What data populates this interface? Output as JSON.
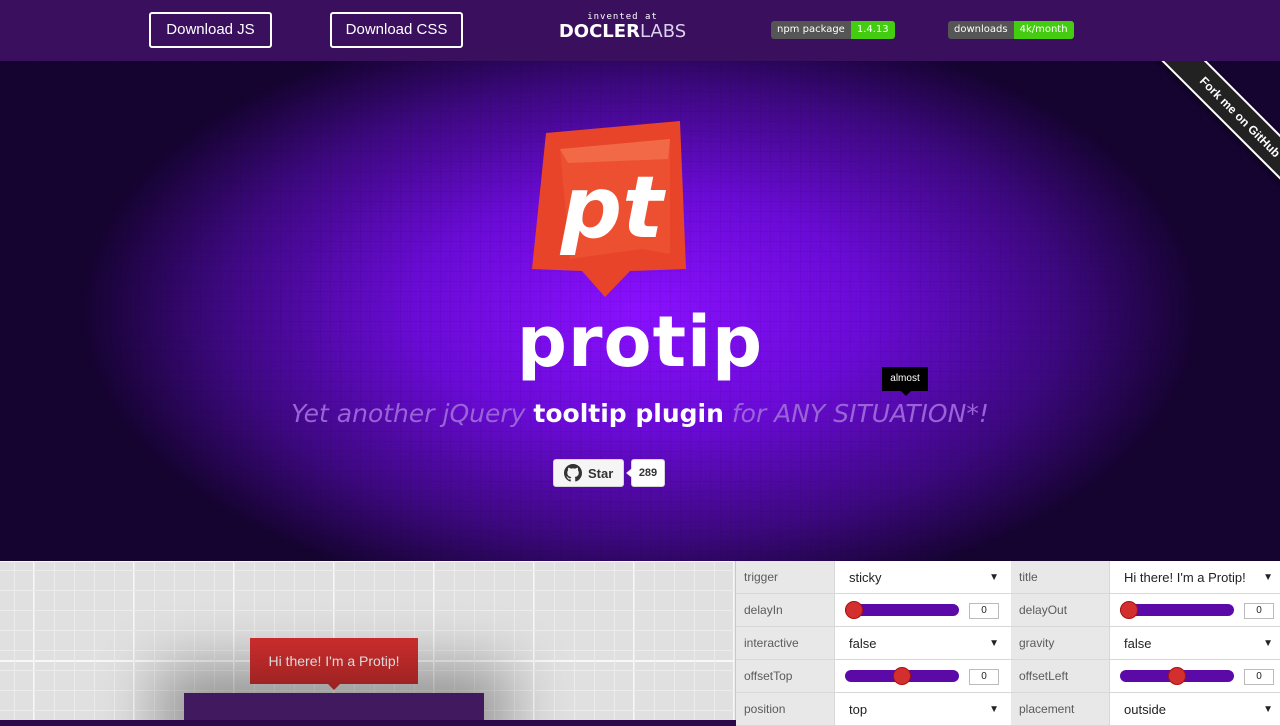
{
  "header": {
    "download_js": "Download JS",
    "download_css": "Download CSS",
    "logo_small": "invented at",
    "logo_main": "DOCLER",
    "logo_labs": "LABS",
    "npm_badge": {
      "label": "npm package",
      "value": "1.4.13"
    },
    "downloads_badge": {
      "label": "downloads",
      "value": "4k/month"
    }
  },
  "hero": {
    "title": "protip",
    "logo_letters": "pt",
    "tagline_pre": "Yet another jQuery ",
    "tagline_bold": "tooltip plugin",
    "tagline_post": " for ANY SITUATION*!",
    "almost_tip": "almost",
    "star_label": "Star",
    "star_count": "289",
    "fork_ribbon": "Fork me on GitHub"
  },
  "demo": {
    "tooltip_text": "Hi there! I'm a Protip!"
  },
  "controls": {
    "trigger": {
      "label": "trigger",
      "value": "sticky"
    },
    "title": {
      "label": "title",
      "value": "Hi there! I'm a Protip!"
    },
    "delayIn": {
      "label": "delayIn",
      "value": "0",
      "level": 0
    },
    "delayOut": {
      "label": "delayOut",
      "value": "0",
      "level": 0
    },
    "interactive": {
      "label": "interactive",
      "value": "false"
    },
    "gravity": {
      "label": "gravity",
      "value": "false"
    },
    "offsetTop": {
      "label": "offsetTop",
      "value": "0",
      "level": 0.5
    },
    "offsetLeft": {
      "label": "offsetLeft",
      "value": "0",
      "level": 0.5
    },
    "position": {
      "label": "position",
      "value": "top"
    },
    "placement": {
      "label": "placement",
      "value": "outside"
    }
  },
  "colors": {
    "accent": "#8a10ff",
    "tooltip_red": "#d32f2f",
    "slider_track": "#5b0aa8",
    "logo_orange": "#e8442a"
  }
}
